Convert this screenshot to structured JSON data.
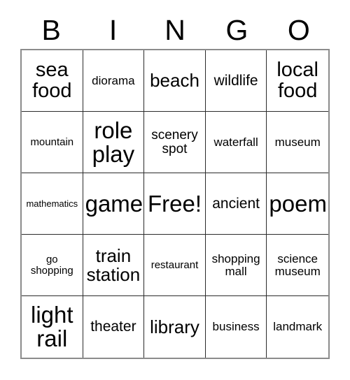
{
  "header": {
    "letters": [
      "B",
      "I",
      "N",
      "G",
      "O"
    ]
  },
  "grid": {
    "rows": 5,
    "columns": 5,
    "cells": [
      {
        "text": "sea food",
        "size": "fs-xl"
      },
      {
        "text": "diorama",
        "size": "fs-xs"
      },
      {
        "text": "beach",
        "size": "fs-lg"
      },
      {
        "text": "wildlife",
        "size": "fs-md"
      },
      {
        "text": "local food",
        "size": "fs-xl"
      },
      {
        "text": "mountain",
        "size": "fs-xxs"
      },
      {
        "text": "role play",
        "size": "fs-xxl"
      },
      {
        "text": "scenery spot",
        "size": "fs-sm"
      },
      {
        "text": "waterfall",
        "size": "fs-xs"
      },
      {
        "text": "museum",
        "size": "fs-xs"
      },
      {
        "text": "mathematics",
        "size": "fs-tiny"
      },
      {
        "text": "game",
        "size": "fs-xxl"
      },
      {
        "text": "Free!",
        "size": "fs-xxl"
      },
      {
        "text": "ancient",
        "size": "fs-md"
      },
      {
        "text": "poem",
        "size": "fs-xxl"
      },
      {
        "text": "go shopping",
        "size": "fs-xxs"
      },
      {
        "text": "train station",
        "size": "fs-lg"
      },
      {
        "text": "restaurant",
        "size": "fs-xxs"
      },
      {
        "text": "shopping mall",
        "size": "fs-xs"
      },
      {
        "text": "science museum",
        "size": "fs-xs"
      },
      {
        "text": "light rail",
        "size": "fs-xxl"
      },
      {
        "text": "theater",
        "size": "fs-md"
      },
      {
        "text": "library",
        "size": "fs-lg"
      },
      {
        "text": "business",
        "size": "fs-xs"
      },
      {
        "text": "landmark",
        "size": "fs-xs"
      }
    ]
  },
  "colors": {
    "background": "#ffffff",
    "text": "#000000",
    "grid_line": "#2b2b2b",
    "grid_outer": "#8c8c8c"
  }
}
